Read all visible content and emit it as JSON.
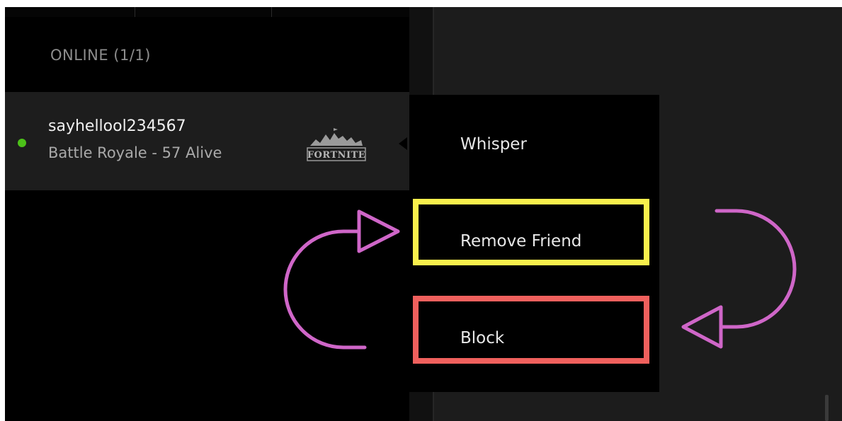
{
  "friends_panel": {
    "section_header": "ONLINE (1/1)",
    "friend": {
      "name": "sayhellool234567",
      "status": "Battle Royale - 57 Alive",
      "game_logo_text": "FORTNITE",
      "online_color": "#4cc119"
    }
  },
  "context_menu": {
    "items": [
      {
        "label": "Whisper"
      },
      {
        "label": "Remove Friend"
      },
      {
        "label": "Block"
      }
    ]
  },
  "annotations": {
    "remove_friend_highlight_color": "#f9f04c",
    "block_highlight_color": "#f0605d",
    "arrow_color": "#cf66c8"
  }
}
